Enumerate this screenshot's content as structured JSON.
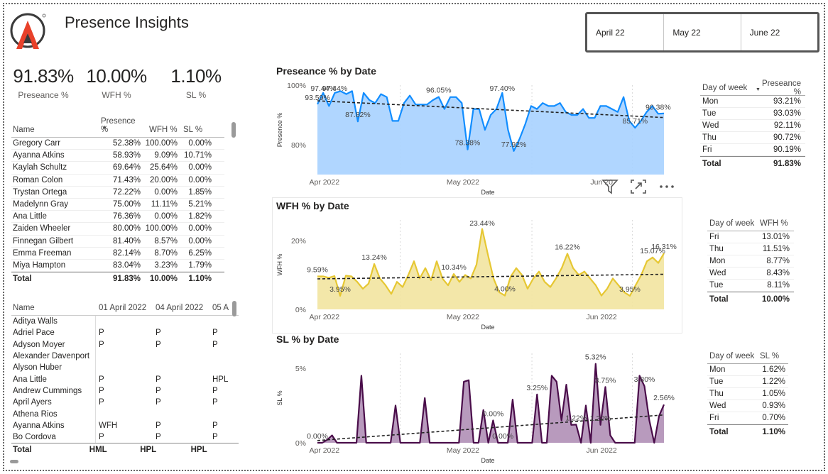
{
  "app": {
    "title": "Presence Insights"
  },
  "slicer": {
    "items": [
      "April 22",
      "May 22",
      "June 22"
    ]
  },
  "kpis": [
    {
      "value": "91.83%",
      "label": "Preseance %"
    },
    {
      "value": "10.00%",
      "label": "WFH %"
    },
    {
      "value": "1.10%",
      "label": "SL %"
    }
  ],
  "people_table": {
    "columns": [
      "Name",
      "Presence %",
      "WFH %",
      "SL %"
    ],
    "rows": [
      [
        "Gregory Carr",
        "52.38%",
        "100.00%",
        "0.00%"
      ],
      [
        "Ayanna Atkins",
        "58.93%",
        "9.09%",
        "10.71%"
      ],
      [
        "Kaylah Schultz",
        "69.64%",
        "25.64%",
        "0.00%"
      ],
      [
        "Roman Colon",
        "71.43%",
        "20.00%",
        "0.00%"
      ],
      [
        "Trystan Ortega",
        "72.22%",
        "0.00%",
        "1.85%"
      ],
      [
        "Madelynn Gray",
        "75.00%",
        "11.11%",
        "5.21%"
      ],
      [
        "Ana Little",
        "76.36%",
        "0.00%",
        "1.82%"
      ],
      [
        "Zaiden Wheeler",
        "80.00%",
        "100.00%",
        "0.00%"
      ],
      [
        "Finnegan Gilbert",
        "81.40%",
        "8.57%",
        "0.00%"
      ],
      [
        "Emma Freeman",
        "82.14%",
        "8.70%",
        "6.25%"
      ],
      [
        "Miya Hampton",
        "83.04%",
        "3.23%",
        "1.79%"
      ]
    ],
    "total": [
      "Total",
      "91.83%",
      "10.00%",
      "1.10%"
    ]
  },
  "attendance_table": {
    "columns": [
      "Name",
      "01 April 2022",
      "04 April 2022",
      "05 A"
    ],
    "rows": [
      [
        "Aditya Walls",
        "",
        "",
        ""
      ],
      [
        "Adriel Pace",
        "P",
        "P",
        "P"
      ],
      [
        "Adyson Moyer",
        "P",
        "P",
        "P"
      ],
      [
        "Alexander Davenport",
        "",
        "",
        ""
      ],
      [
        "Alyson Huber",
        "",
        "",
        ""
      ],
      [
        "Ana Little",
        "P",
        "P",
        "HPL"
      ],
      [
        "Andrew Cummings",
        "P",
        "P",
        "P"
      ],
      [
        "April Ayers",
        "P",
        "P",
        "P"
      ],
      [
        "Athena Rios",
        "",
        "",
        ""
      ],
      [
        "Ayanna Atkins",
        "WFH",
        "P",
        "P"
      ],
      [
        "Bo Cordova",
        "P",
        "P",
        "P"
      ]
    ],
    "total": [
      "Total",
      "HML",
      "HPL",
      "HPL"
    ]
  },
  "charts_text": {
    "presence": {
      "title": "Preseance % by Date",
      "xlabel": "Date",
      "ylabel": "Presence %",
      "y_ticks": [
        "100%",
        "80%"
      ],
      "x_ticks": [
        "Apr 2022",
        "May 2022",
        "Jun 20"
      ],
      "annotations": [
        "97.44%",
        "97.44%",
        "93.59%",
        "87.82%",
        "96.05%",
        "78.38%",
        "77.92%",
        "97.40%",
        "90.38%",
        "85.71%"
      ]
    },
    "wfh": {
      "title": "WFH % by Date",
      "xlabel": "Date",
      "ylabel": "WFH %",
      "y_ticks": [
        "20%",
        "0%"
      ],
      "x_ticks": [
        "Apr 2022",
        "May 2022",
        "Jun 2022"
      ],
      "annotations": [
        "9.59%",
        "13.24%",
        "3.95%",
        "10.34%",
        "23.44%",
        "4.00%",
        "16.22%",
        "3.95%",
        "15.07%",
        "16.31%"
      ]
    },
    "sl": {
      "title": "SL % by Date",
      "xlabel": "Date",
      "ylabel": "SL %",
      "y_ticks": [
        "5%",
        "0%"
      ],
      "x_ticks": [
        "Apr 2022",
        "May 2022",
        "Jun 2022"
      ],
      "annotations": [
        "0.00%",
        "3.25%",
        "0.00%",
        "0.00%",
        "1.22%",
        "1.20%",
        "5.32%",
        "3.75%",
        "3.80%",
        "2.56%"
      ]
    }
  },
  "chart_data": [
    {
      "type": "area",
      "title": "Preseance % by Date",
      "xlabel": "Date",
      "ylabel": "Presence %",
      "ylim": [
        70,
        100
      ],
      "color": "#118DFF",
      "fill": "#A7D1FF",
      "trendline": true,
      "values": [
        93.6,
        97.4,
        93,
        97.4,
        98,
        97,
        98,
        87.8,
        97.4,
        95,
        94,
        97,
        96,
        88,
        88,
        94,
        96.5,
        93.5,
        93.5,
        93.5,
        95,
        96.05,
        92,
        96,
        96,
        94,
        78.4,
        92,
        92,
        85,
        90,
        92,
        97.4,
        85,
        77.9,
        82,
        87,
        93,
        92,
        94,
        93,
        93,
        94,
        91,
        90,
        90,
        92,
        89,
        89,
        93,
        93,
        92,
        91,
        96,
        88,
        85.7,
        88,
        91,
        93,
        90.4,
        90.5
      ]
    },
    {
      "type": "area",
      "title": "WFH % by Date",
      "xlabel": "Date",
      "ylabel": "WFH %",
      "ylim": [
        0,
        26
      ],
      "color": "#E6C733",
      "fill": "#F2E4A0",
      "trendline": true,
      "values": [
        9.6,
        9.6,
        9.2,
        9.7,
        3.95,
        9.8,
        9.6,
        8,
        6,
        7.5,
        13.2,
        9,
        7,
        4.5,
        8,
        6.5,
        10,
        14,
        9,
        12,
        8.5,
        14,
        9,
        7,
        10.3,
        8,
        10,
        9,
        13,
        23.4,
        16,
        9,
        5,
        4,
        9.5,
        12,
        10,
        6,
        9,
        11,
        8,
        6.5,
        9,
        12,
        16.2,
        12,
        10,
        11,
        9,
        7,
        4,
        6,
        9,
        7,
        5,
        3.95,
        7,
        10,
        14,
        15.1,
        13.5,
        16.3
      ]
    },
    {
      "type": "area",
      "title": "SL % by Date",
      "xlabel": "Date",
      "ylabel": "SL %",
      "ylim": [
        0,
        6
      ],
      "color": "#4A0D4A",
      "fill": "#B08FB6",
      "trendline": true,
      "values": [
        0,
        0,
        0.2,
        0.5,
        0,
        0,
        0,
        0,
        0,
        4.5,
        0,
        0,
        0,
        0,
        0,
        0,
        2.5,
        0,
        0,
        0,
        0,
        0,
        3,
        0,
        0,
        0,
        0,
        0,
        0,
        0,
        4.1,
        4.2,
        0,
        0,
        2.2,
        0,
        1.5,
        0,
        0,
        0,
        2.9,
        0,
        0,
        0,
        0,
        3.25,
        0,
        0,
        4.5,
        4.1,
        1.5,
        3.9,
        1.2,
        1.22,
        0,
        2.5,
        0,
        5.3,
        1.2,
        3.75,
        0.5,
        0,
        0,
        0,
        0,
        0,
        4.5,
        3.8,
        1.5,
        0,
        1.8,
        2.56
      ]
    }
  ],
  "dow_presence": {
    "columns": [
      "Day of week",
      "Preseance %"
    ],
    "rows": [
      [
        "Mon",
        "93.21%"
      ],
      [
        "Tue",
        "93.03%"
      ],
      [
        "Wed",
        "92.11%"
      ],
      [
        "Thu",
        "90.72%"
      ],
      [
        "Fri",
        "90.19%"
      ]
    ],
    "total": [
      "Total",
      "91.83%"
    ]
  },
  "dow_wfh": {
    "columns": [
      "Day of week",
      "WFH %"
    ],
    "rows": [
      [
        "Fri",
        "13.01%"
      ],
      [
        "Thu",
        "11.51%"
      ],
      [
        "Mon",
        "8.77%"
      ],
      [
        "Wed",
        "8.43%"
      ],
      [
        "Tue",
        "8.11%"
      ]
    ],
    "total": [
      "Total",
      "10.00%"
    ]
  },
  "dow_sl": {
    "columns": [
      "Day of week",
      "SL %"
    ],
    "rows": [
      [
        "Mon",
        "1.62%"
      ],
      [
        "Tue",
        "1.22%"
      ],
      [
        "Thu",
        "1.05%"
      ],
      [
        "Wed",
        "0.93%"
      ],
      [
        "Fri",
        "0.70%"
      ]
    ],
    "total": [
      "Total",
      "1.10%"
    ]
  },
  "icons": [
    "filter-icon",
    "focus-mode-icon",
    "more-options-icon"
  ]
}
